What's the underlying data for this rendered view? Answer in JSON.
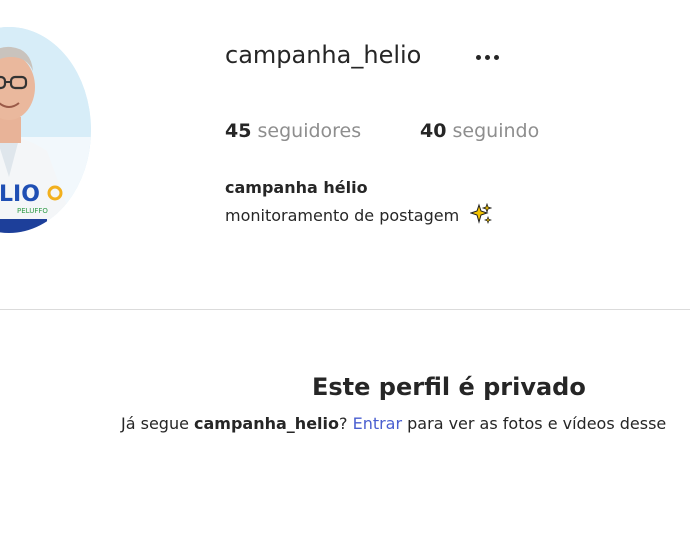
{
  "profile": {
    "username": "campanha_helio",
    "full_name": "campanha hélio",
    "bio": "monitoramento de postagem",
    "avatar_badge_text": "LIO",
    "avatar_badge_subtext": "PELUFFO"
  },
  "stats": {
    "followers_count": "45",
    "followers_label": "seguidores",
    "following_count": "40",
    "following_label": "seguindo"
  },
  "private_notice": {
    "title": "Este perfil é privado",
    "prefix": "Já segue ",
    "username": "campanha_helio",
    "question": "? ",
    "login_link": "Entrar",
    "suffix": " para ver as fotos e vídeos desse"
  },
  "colors": {
    "link": "#4a5fd0",
    "muted": "#8e8e8e",
    "divider": "#dbdbdb"
  },
  "icons": {
    "more": "more-options-icon",
    "bio_emoji": "sparkles-icon"
  }
}
